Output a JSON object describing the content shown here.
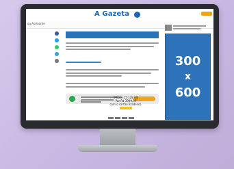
{
  "site": {
    "brand_name": "A Gazeta",
    "brand_color": "#1c68b0"
  },
  "nav": {
    "text": "ou Assinante"
  },
  "share_icons": [
    {
      "name": "facebook-icon",
      "color": "#3b5998"
    },
    {
      "name": "twitter-icon",
      "color": "#1da1f2"
    },
    {
      "name": "whatsapp-icon",
      "color": "#25d366"
    },
    {
      "name": "telegram-icon",
      "color": "#2ca5e0"
    },
    {
      "name": "more-icon",
      "color": "#777777"
    }
  ],
  "ad": {
    "size_top": "300",
    "size_mid": "x",
    "size_bottom": "600",
    "color": "#2e73b9"
  },
  "promo": {
    "product": "iPhone 15 128 GB",
    "price_line": "Por R$ 3999,99",
    "condition": "com o cartão Bradesco."
  },
  "colors": {
    "accent": "#f0a21b",
    "background": "#c7b6e1",
    "monitor": "#2a2b2f"
  }
}
